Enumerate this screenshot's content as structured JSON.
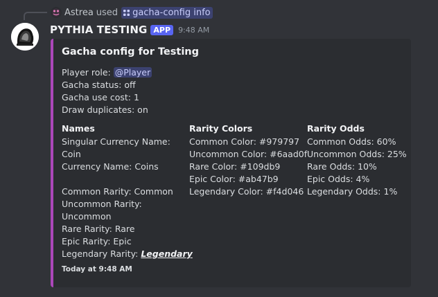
{
  "reply": {
    "user": "Astrea",
    "action": "used",
    "command": "gacha-config info"
  },
  "message": {
    "username": "PYTHIA TESTING",
    "badge": "APP",
    "time": "9:48 AM"
  },
  "embed": {
    "accent_color": "#ab47b9",
    "title": "Gacha config for Testing",
    "description": {
      "player_role_label": "Player role: ",
      "player_role_mention": "@Player",
      "gacha_status": "Gacha status: off",
      "gacha_cost": "Gacha use cost: 1",
      "draw_duplicates": "Draw duplicates: on"
    },
    "fields": {
      "names": {
        "title": "Names",
        "singular_label": "Singular Currency Name:",
        "singular_value": "Coin",
        "currency": "Currency Name: Coins",
        "common": "Common Rarity: Common",
        "uncommon_label": "Uncommon Rarity:",
        "uncommon_value": "Uncommon",
        "rare": "Rare Rarity: Rare",
        "epic": "Epic Rarity: Epic",
        "legendary_label": "Legendary Rarity: ",
        "legendary_value": "Legendary"
      },
      "colors": {
        "title": "Rarity Colors",
        "lines": [
          "Common Color: #979797",
          "Uncommon Color: #6aad0f",
          "Rare Color: #109db9",
          "Epic Color: #ab47b9",
          "Legendary Color: #f4d046"
        ]
      },
      "odds": {
        "title": "Rarity Odds",
        "lines": [
          "Common Odds: 60%",
          "Uncommon Odds: 25%",
          "Rare Odds: 10%",
          "Epic Odds: 4%",
          "Legendary Odds: 1%"
        ]
      }
    },
    "footer": "Today at 9:48 AM"
  },
  "icons": {
    "reply_avatar": "pink-creature-avatar-icon",
    "command": "slash-command-icon",
    "bot_avatar": "pythia-bot-avatar"
  }
}
